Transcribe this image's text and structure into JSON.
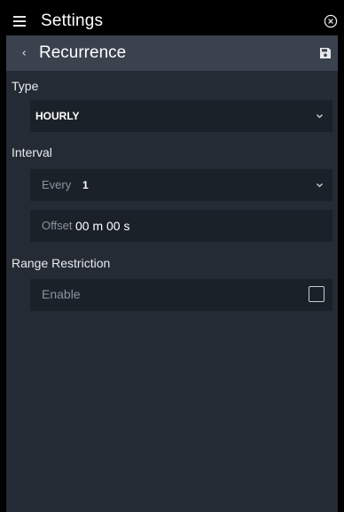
{
  "header": {
    "title": "Settings",
    "menu_icon": "hamburger-menu-icon",
    "close_icon": "close-circle-icon"
  },
  "subheader": {
    "title": "Recurrence",
    "back_icon": "chevron-left-icon",
    "save_icon": "save-disk-icon"
  },
  "type": {
    "label": "Type",
    "selected": "HOURLY"
  },
  "interval": {
    "label": "Interval",
    "every_label": "Every",
    "every_value": "1",
    "offset_label": "Offset",
    "offset_value": "00 m 00 s"
  },
  "range": {
    "label": "Range Restriction",
    "enable_label": "Enable",
    "enabled": false
  },
  "colors": {
    "background": "#242b34",
    "topbar": "#000000",
    "subheader": "#3a424e",
    "field": "#1b2129",
    "text": "#ffffff",
    "muted_text": "#8b939d"
  }
}
